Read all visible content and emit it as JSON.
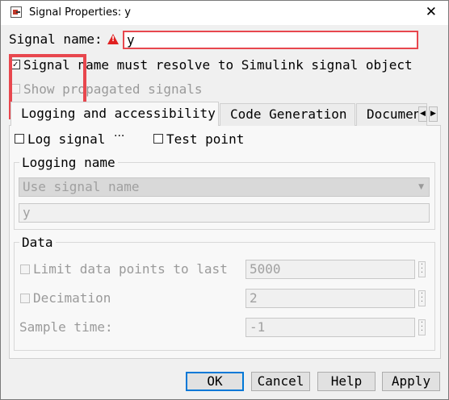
{
  "window": {
    "title": "Signal Properties: y",
    "close_glyph": "✕"
  },
  "signal_name": {
    "label": "Signal name:",
    "value": "y"
  },
  "checks": {
    "resolve": {
      "label": "Signal name must resolve to Simulink signal object",
      "checked": true
    },
    "propagated": {
      "label": "Show propagated signals",
      "checked": false,
      "disabled": true
    }
  },
  "tabs": [
    {
      "label": "Logging and accessibility",
      "active": true
    },
    {
      "label": "Code Generation",
      "active": false
    },
    {
      "label": "Documentation",
      "active": false
    }
  ],
  "logging": {
    "log_signal": {
      "label": "Log signal",
      "checked": false
    },
    "log_signal_more": "···",
    "test_point": {
      "label": "Test point",
      "checked": false
    },
    "logging_name": {
      "title": "Logging name",
      "mode": "Use signal name",
      "value": "y"
    }
  },
  "data": {
    "title": "Data",
    "limit": {
      "label": "Limit data points to last",
      "value": "5000",
      "checked": false
    },
    "decimation": {
      "label": "Decimation",
      "value": "2",
      "checked": false
    },
    "sample_time": {
      "label": "Sample time:",
      "value": "-1"
    }
  },
  "buttons": {
    "ok": "OK",
    "cancel": "Cancel",
    "help": "Help",
    "apply": "Apply"
  },
  "icons": [
    "signal-properties-app-icon",
    "warning-icon",
    "close-icon",
    "scroll-left-icon",
    "scroll-right-icon",
    "ellipsis-icon"
  ],
  "colors": {
    "highlight": "#e8474e",
    "default_button_border": "#0078d7",
    "warning": "#e02020"
  }
}
